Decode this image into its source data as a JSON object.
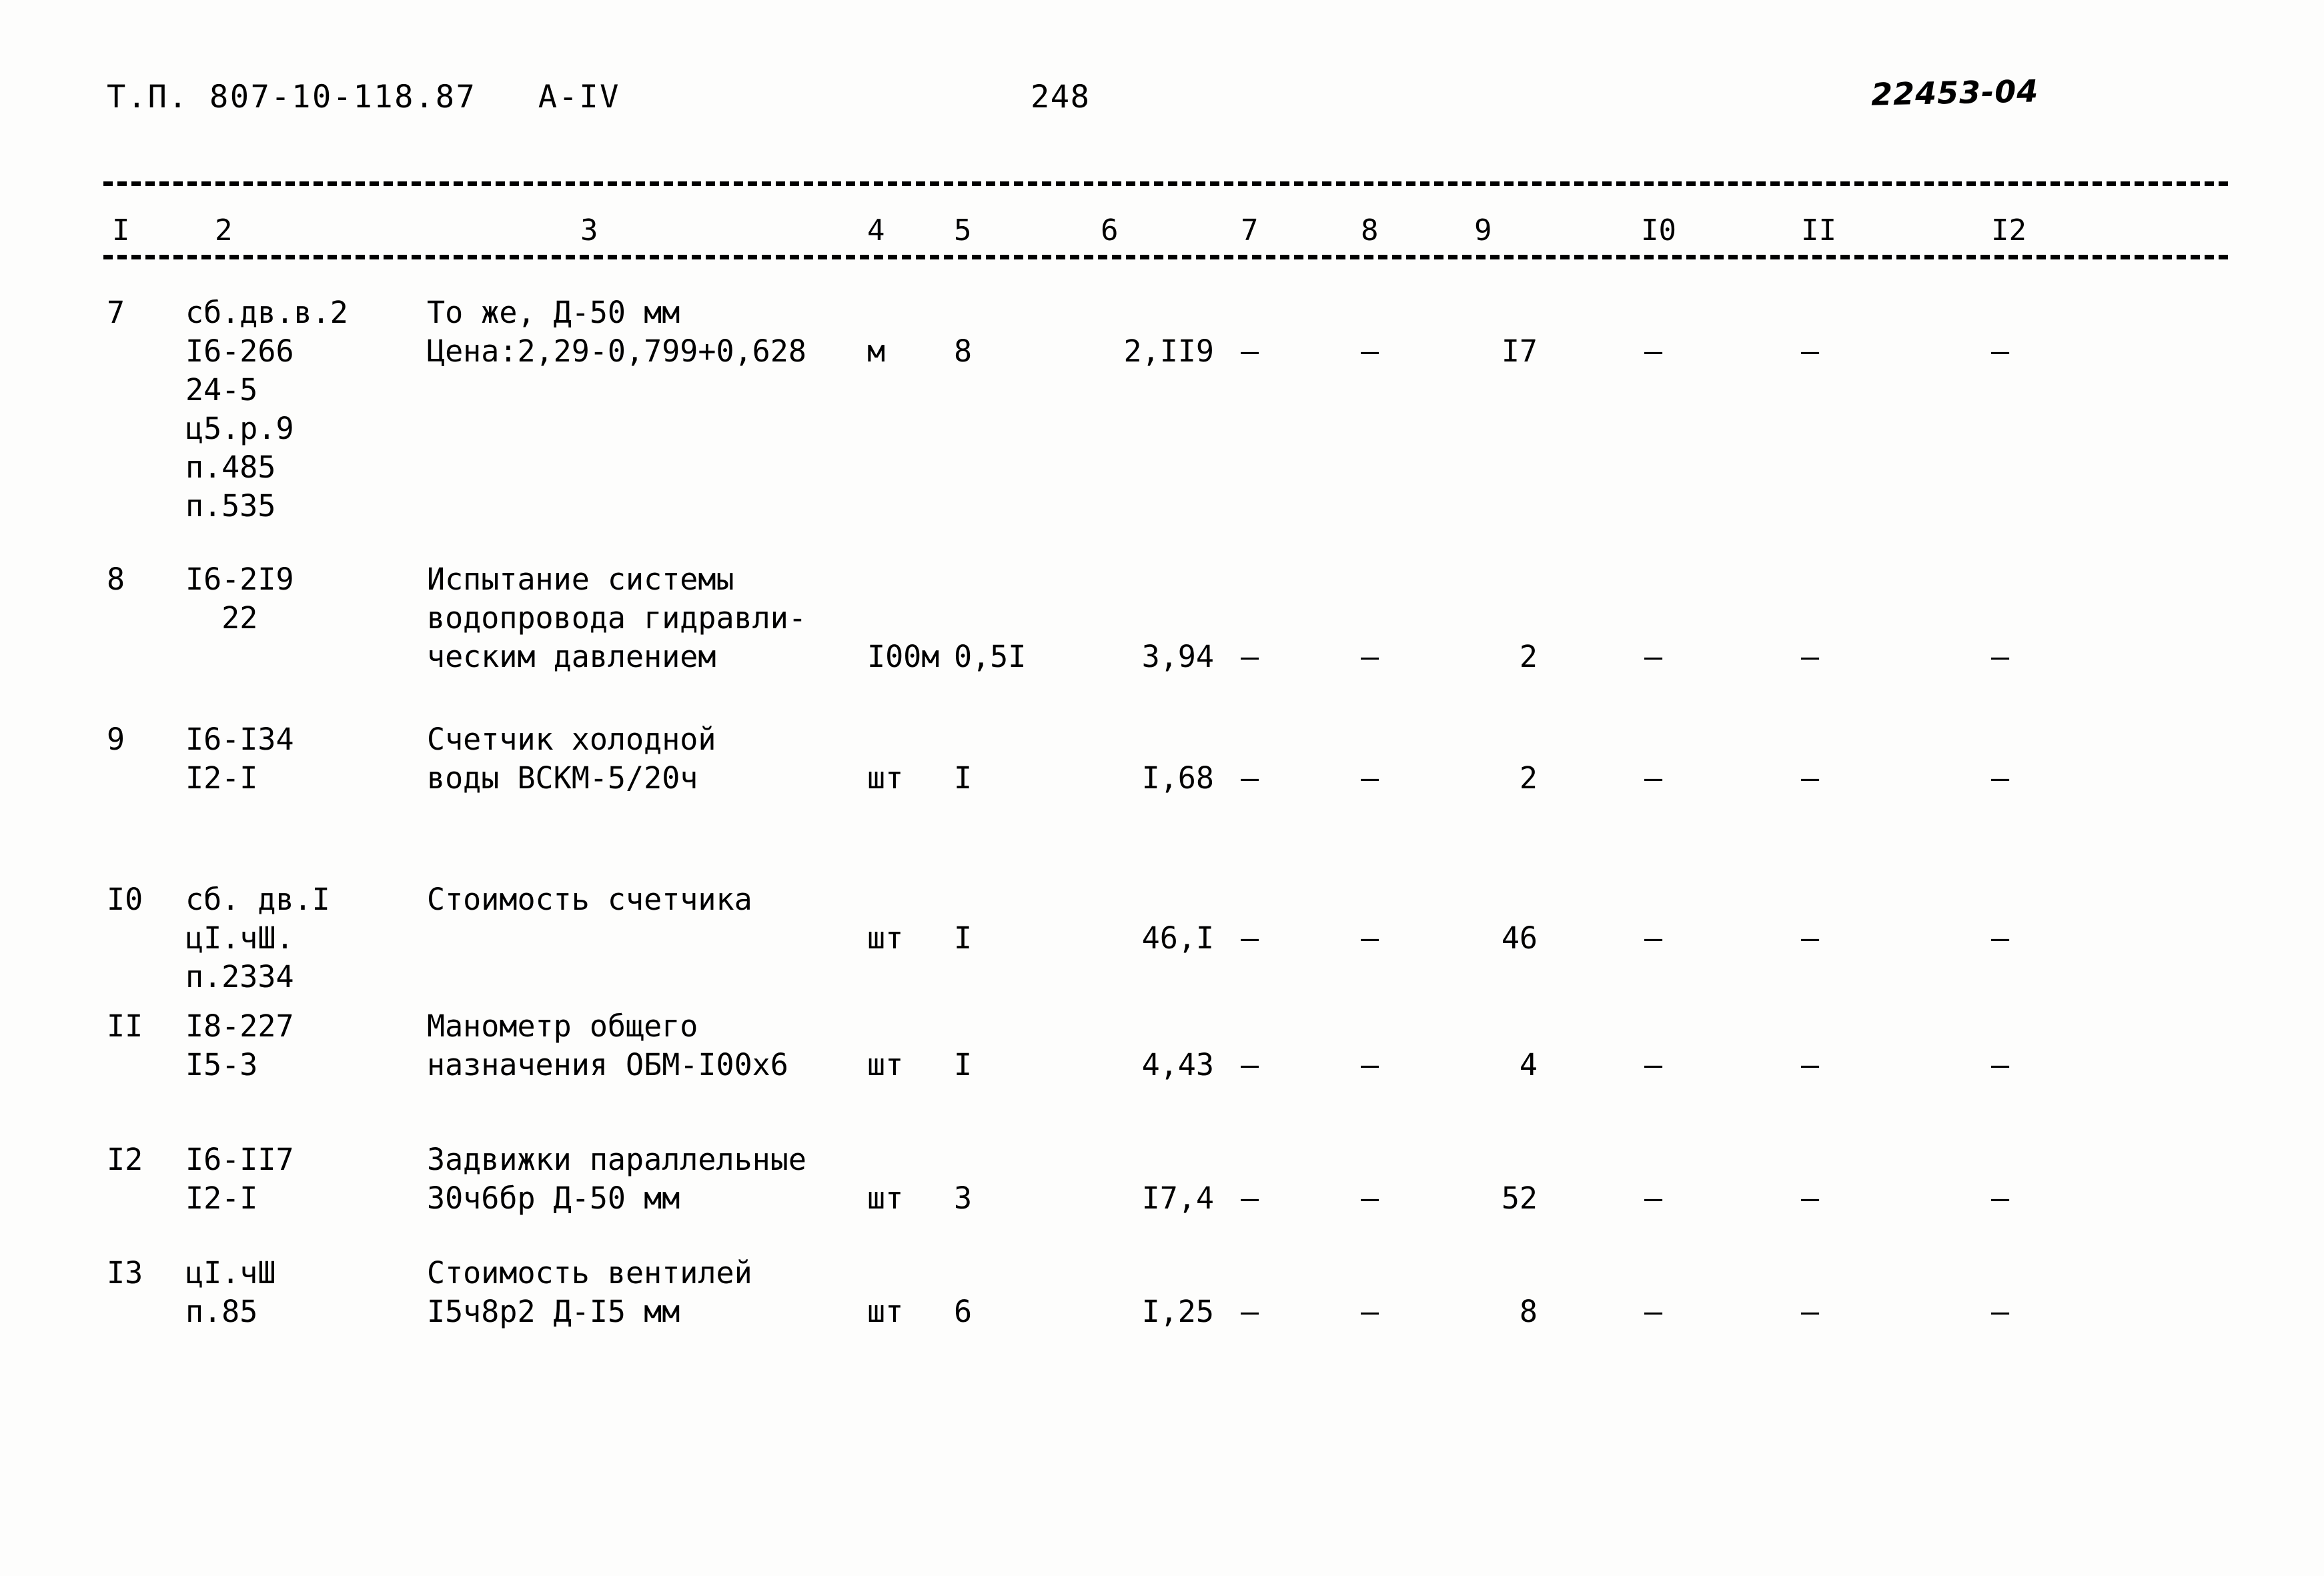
{
  "header": {
    "document_code": "Т.П. 807-10-118.87   А-IV",
    "page_number": "248",
    "stamp": "22453-04"
  },
  "table": {
    "column_numbers": [
      "I",
      "2",
      "3",
      "4",
      "5",
      "6",
      "7",
      "8",
      "9",
      "I0",
      "II",
      "I2"
    ],
    "rows": [
      {
        "num": "7",
        "codes": [
          "сб.дв.в.2",
          "I6-266",
          "24-5",
          "ц5.р.9",
          "п.485",
          "п.535"
        ],
        "desc": [
          "То же, Д-50 мм",
          "Цена:2,29-0,799+0,628"
        ],
        "unit": "м",
        "qty": "8",
        "v6": "2,II9",
        "v7": "–",
        "v8": "–",
        "v9": "I7",
        "v10": "–",
        "v11": "–",
        "v12": "–"
      },
      {
        "num": "8",
        "codes": [
          "I6-2I9",
          "  22"
        ],
        "desc": [
          "Испытание системы",
          "водопровода гидравли-",
          "ческим давлением"
        ],
        "unit": "I00м",
        "qty": "0,5I",
        "v6": "3,94",
        "v7": "–",
        "v8": "–",
        "v9": "2",
        "v10": "–",
        "v11": "–",
        "v12": "–"
      },
      {
        "num": "9",
        "codes": [
          "I6-I34",
          "I2-I"
        ],
        "desc": [
          "Счетчик холодной",
          "воды ВСКМ-5/20ч"
        ],
        "unit": "шт",
        "qty": "I",
        "v6": "I,68",
        "v7": "–",
        "v8": "–",
        "v9": "2",
        "v10": "–",
        "v11": "–",
        "v12": "–"
      },
      {
        "num": "I0",
        "codes": [
          "сб. дв.I",
          "цI.чШ.",
          "п.2334"
        ],
        "desc": [
          "Стоимость счетчика"
        ],
        "unit": "шт",
        "qty": "I",
        "v6": "46,I",
        "v7": "–",
        "v8": "–",
        "v9": "46",
        "v10": "–",
        "v11": "–",
        "v12": "–"
      },
      {
        "num": "II",
        "codes": [
          "I8-227",
          "I5-3"
        ],
        "desc": [
          "Манометр общего",
          "назначения ОБМ-I00х6"
        ],
        "unit": "шт",
        "qty": "I",
        "v6": "4,43",
        "v7": "–",
        "v8": "–",
        "v9": "4",
        "v10": "–",
        "v11": "–",
        "v12": "–"
      },
      {
        "num": "I2",
        "codes": [
          "I6-II7",
          "I2-I"
        ],
        "desc": [
          "Задвижки параллельные",
          "30ч6бр Д-50 мм"
        ],
        "unit": "шт",
        "qty": "3",
        "v6": "I7,4",
        "v7": "–",
        "v8": "–",
        "v9": "52",
        "v10": "–",
        "v11": "–",
        "v12": "–"
      },
      {
        "num": "I3",
        "codes": [
          "цI.чШ",
          "п.85"
        ],
        "desc": [
          "Стоимость вентилей",
          "I5ч8р2 Д-I5 мм"
        ],
        "unit": "шт",
        "qty": "6",
        "v6": "I,25",
        "v7": "–",
        "v8": "–",
        "v9": "8",
        "v10": "–",
        "v11": "–",
        "v12": "–"
      }
    ]
  }
}
